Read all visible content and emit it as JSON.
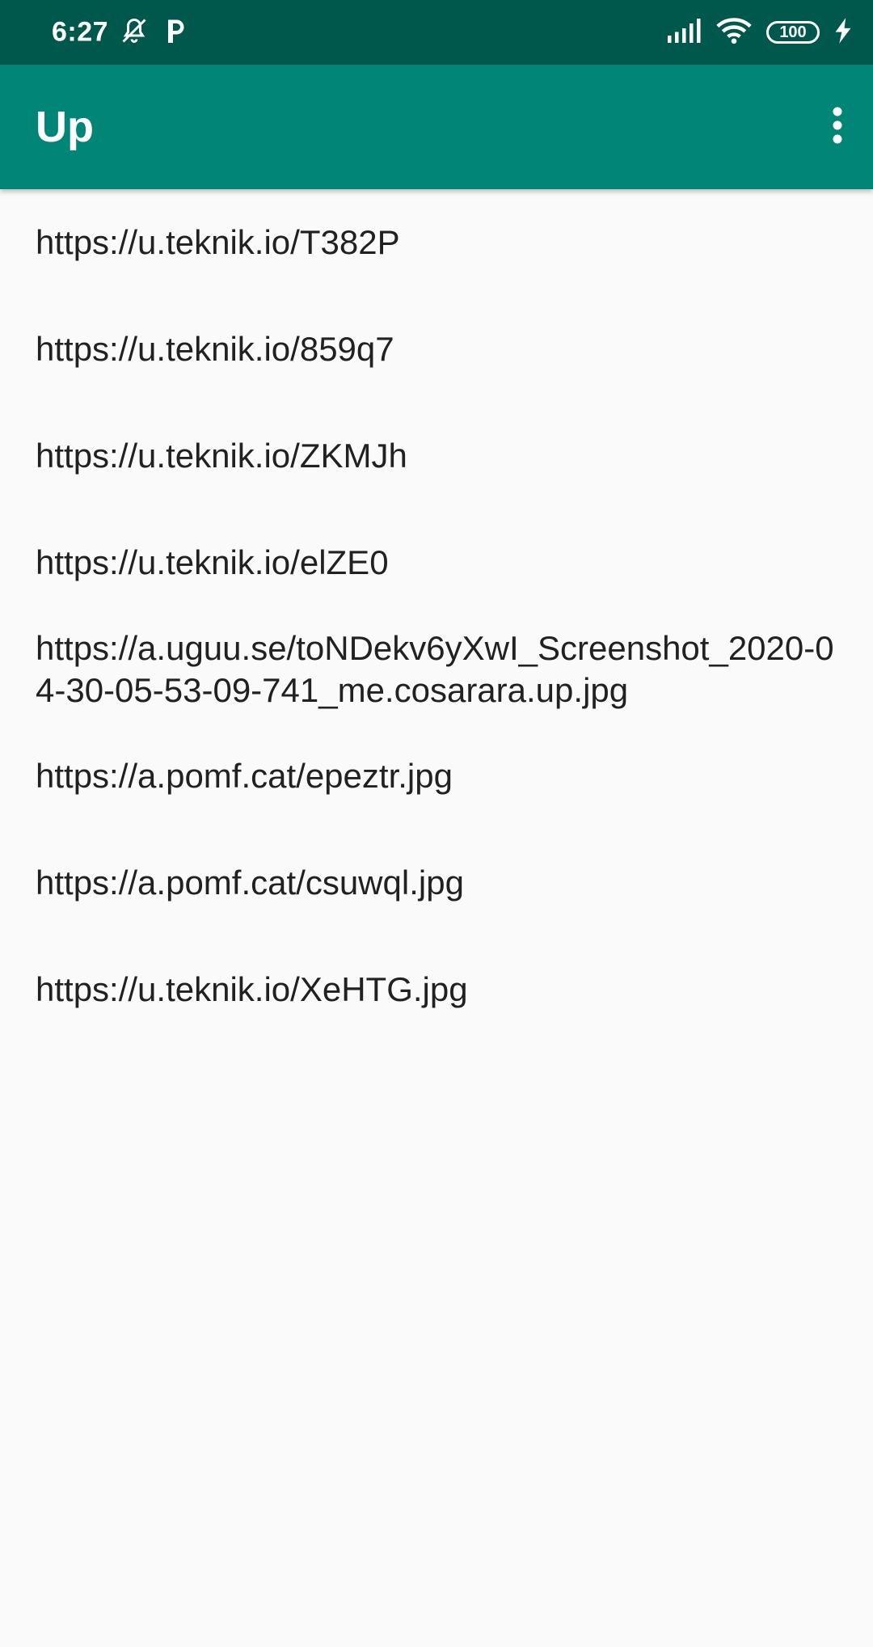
{
  "status_bar": {
    "time": "6:27",
    "battery": "100",
    "icons": [
      "mute-bell-icon",
      "parking-p-icon",
      "signal-icon",
      "wifi-icon",
      "battery-icon",
      "charging-bolt-icon"
    ]
  },
  "app_bar": {
    "title": "Up",
    "overflow_icon": "more-vert-icon",
    "color": "#008577",
    "status_color": "#00574b"
  },
  "uploads": [
    {
      "url": "https://u.teknik.io/T382P"
    },
    {
      "url": "https://u.teknik.io/859q7"
    },
    {
      "url": "https://u.teknik.io/ZKMJh"
    },
    {
      "url": "https://u.teknik.io/elZE0"
    },
    {
      "url": "https://a.uguu.se/toNDekv6yXwI_Screenshot_2020-04-30-05-53-09-741_me.cosarara.up.jpg"
    },
    {
      "url": "https://a.pomf.cat/epeztr.jpg"
    },
    {
      "url": "https://a.pomf.cat/csuwql.jpg"
    },
    {
      "url": "https://u.teknik.io/XeHTG.jpg"
    }
  ]
}
